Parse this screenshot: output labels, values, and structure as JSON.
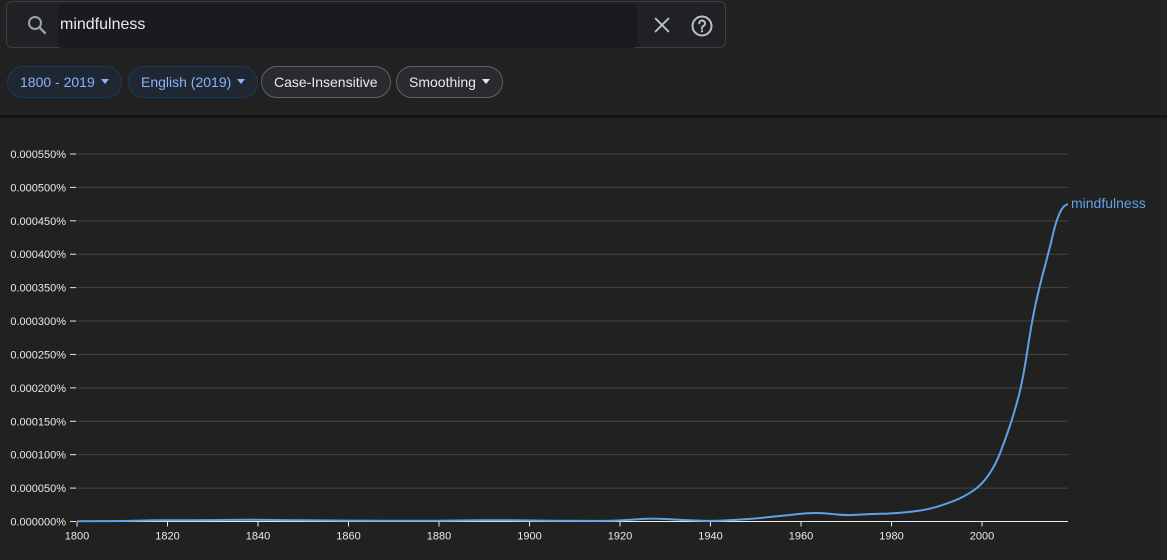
{
  "search": {
    "query": "mindfulness"
  },
  "filters": {
    "year_range": "1800 - 2019",
    "corpus": "English (2019)",
    "case": "Case-Insensitive",
    "smoothing": "Smoothing"
  },
  "colors": {
    "series": "#5ea1e6",
    "grid": "#444444",
    "accent": "#8ab4f8"
  },
  "chart_data": {
    "type": "line",
    "ylim": [
      0,
      0.00055
    ],
    "xlim": [
      1800,
      2019
    ],
    "ytick_values": [
      0,
      5e-05,
      0.0001,
      0.00015,
      0.0002,
      0.00025,
      0.0003,
      0.00035,
      0.0004,
      0.00045,
      0.0005,
      0.00055
    ],
    "ytick_labels": [
      "0.000000%",
      "0.000050%",
      "0.000100%",
      "0.000150%",
      "0.000200%",
      "0.000250%",
      "0.000300%",
      "0.000350%",
      "0.000400%",
      "0.000450%",
      "0.000500%",
      "0.000550%"
    ],
    "xtick_values": [
      1800,
      1820,
      1840,
      1860,
      1880,
      1900,
      1920,
      1940,
      1960,
      1980,
      2000
    ],
    "xtick_labels": [
      "1800",
      "1820",
      "1840",
      "1860",
      "1880",
      "1900",
      "1920",
      "1940",
      "1960",
      "1980",
      "2000"
    ],
    "grid": true,
    "series": [
      {
        "name": "mindfulness",
        "x": [
          1800,
          1810,
          1815,
          1820,
          1830,
          1838,
          1845,
          1855,
          1865,
          1875,
          1885,
          1892,
          1900,
          1910,
          1918,
          1924,
          1928,
          1932,
          1936,
          1940,
          1945,
          1950,
          1955,
          1960,
          1963,
          1966,
          1970,
          1975,
          1980,
          1984,
          1988,
          1992,
          1996,
          2000,
          2003,
          2005,
          2007,
          2009,
          2011,
          2013,
          2015,
          2016,
          2017,
          2018,
          2019
        ],
        "y": [
          3e-07,
          8e-07,
          1.5e-06,
          2e-06,
          2e-06,
          2.8e-06,
          2e-06,
          1.5e-06,
          1.2e-06,
          1e-06,
          1.5e-06,
          2e-06,
          1.5e-06,
          1e-06,
          8e-07,
          3.5e-06,
          4.5e-06,
          3e-06,
          1.5e-06,
          8e-07,
          2e-06,
          4.5e-06,
          8e-06,
          1.15e-05,
          1.3e-05,
          1.2e-05,
          9e-06,
          1.1e-05,
          1.2e-05,
          1.4e-05,
          1.8e-05,
          2.6e-05,
          3.7e-05,
          5.5e-05,
          8.5e-05,
          0.00012,
          0.00016,
          0.00021,
          0.0003,
          0.00036,
          0.00041,
          0.00044,
          0.00046,
          0.000472,
          0.000475
        ]
      }
    ]
  }
}
